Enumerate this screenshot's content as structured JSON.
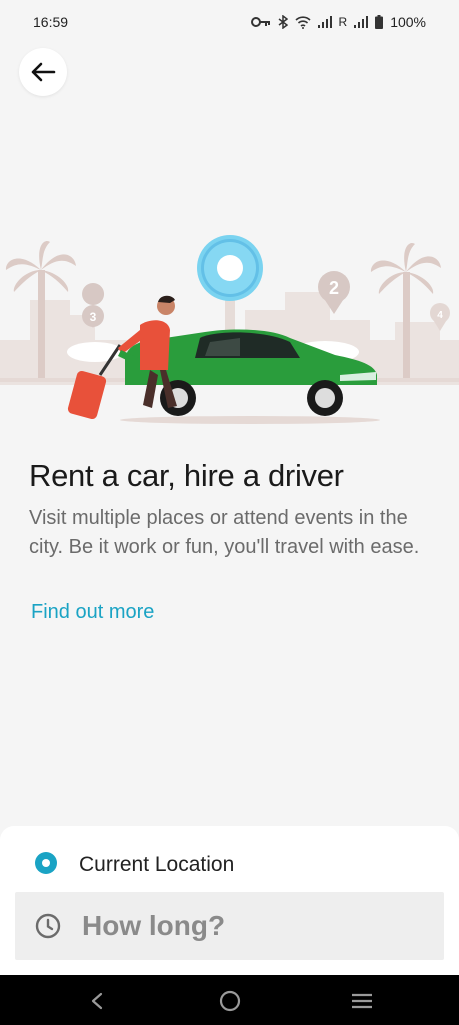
{
  "status_bar": {
    "time": "16:59",
    "roaming": "R",
    "battery": "100%",
    "icons": [
      "vpn-key-icon",
      "bluetooth-icon",
      "wifi-icon",
      "signal-icon",
      "signal-icon",
      "battery-icon"
    ]
  },
  "header": {
    "back_icon": "arrow-left-icon"
  },
  "illustration": {
    "pin_labels": [
      "3",
      "2",
      "4"
    ],
    "colors": {
      "car": "#2a9d3c",
      "pin": "#7ad3f0",
      "luggage": "#e8513a",
      "scene": "#e6dcd8"
    }
  },
  "content": {
    "headline": "Rent a car, hire a driver",
    "description": "Visit multiple places or attend events in the city. Be it work or fun, you'll travel with ease.",
    "link": "Find out more"
  },
  "booking": {
    "location_label": "Current Location",
    "duration_placeholder": "How long?",
    "accent_color": "#1aa3c4"
  },
  "nav_bar": {
    "icons": [
      "back-nav-icon",
      "home-nav-icon",
      "recents-nav-icon"
    ]
  }
}
